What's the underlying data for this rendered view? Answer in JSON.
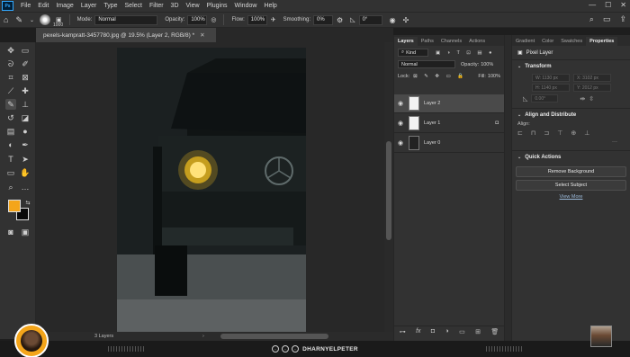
{
  "menubar": {
    "logo": "Ps",
    "items": [
      "File",
      "Edit",
      "Image",
      "Layer",
      "Type",
      "Select",
      "Filter",
      "3D",
      "View",
      "Plugins",
      "Window",
      "Help"
    ]
  },
  "options": {
    "brush_size": "1000",
    "mode_label": "Mode:",
    "mode_value": "Normal",
    "opacity_label": "Opacity:",
    "opacity_value": "100%",
    "flow_label": "Flow:",
    "flow_value": "100%",
    "smoothing_label": "Smoothing:",
    "smoothing_value": "0%",
    "angle_value": "0°"
  },
  "document": {
    "tab_title": "pexels-kampratt-3457780.jpg @ 19.5% (Layer 2, RGB/8) *",
    "status": "3 Layers"
  },
  "colors": {
    "foreground": "#f4a51a",
    "background": "#0a0a0a",
    "headlight": "#f7c21e"
  },
  "layers_panel": {
    "tabs": [
      "Layers",
      "Paths",
      "Channels",
      "Actions"
    ],
    "kind_label": "Kind",
    "blend_mode": "Normal",
    "opacity_label": "Opacity:",
    "opacity_value": "100%",
    "lock_label": "Lock:",
    "fill_label": "Fill:",
    "fill_value": "100%",
    "layers": [
      {
        "name": "Layer 2",
        "selected": true
      },
      {
        "name": "Layer 1",
        "selected": false
      },
      {
        "name": "Layer 0",
        "selected": false
      }
    ]
  },
  "properties_panel": {
    "tabs": [
      "Gradient",
      "Color",
      "Swatches",
      "Properties"
    ],
    "layer_type": "Pixel Layer",
    "transform_title": "Transform",
    "w_label": "W:",
    "w_value": "1130 px",
    "x_label": "X:",
    "x_value": "3102 px",
    "h_label": "H:",
    "h_value": "1140 px",
    "y_label": "Y:",
    "y_value": "2012 px",
    "angle_value": "0.00°",
    "align_title": "Align and Distribute",
    "align_label": "Align:",
    "quick_title": "Quick Actions",
    "remove_bg": "Remove Background",
    "select_subject": "Select Subject",
    "view_more": "View More"
  },
  "branding": {
    "name": "DHARNYELPETER"
  }
}
